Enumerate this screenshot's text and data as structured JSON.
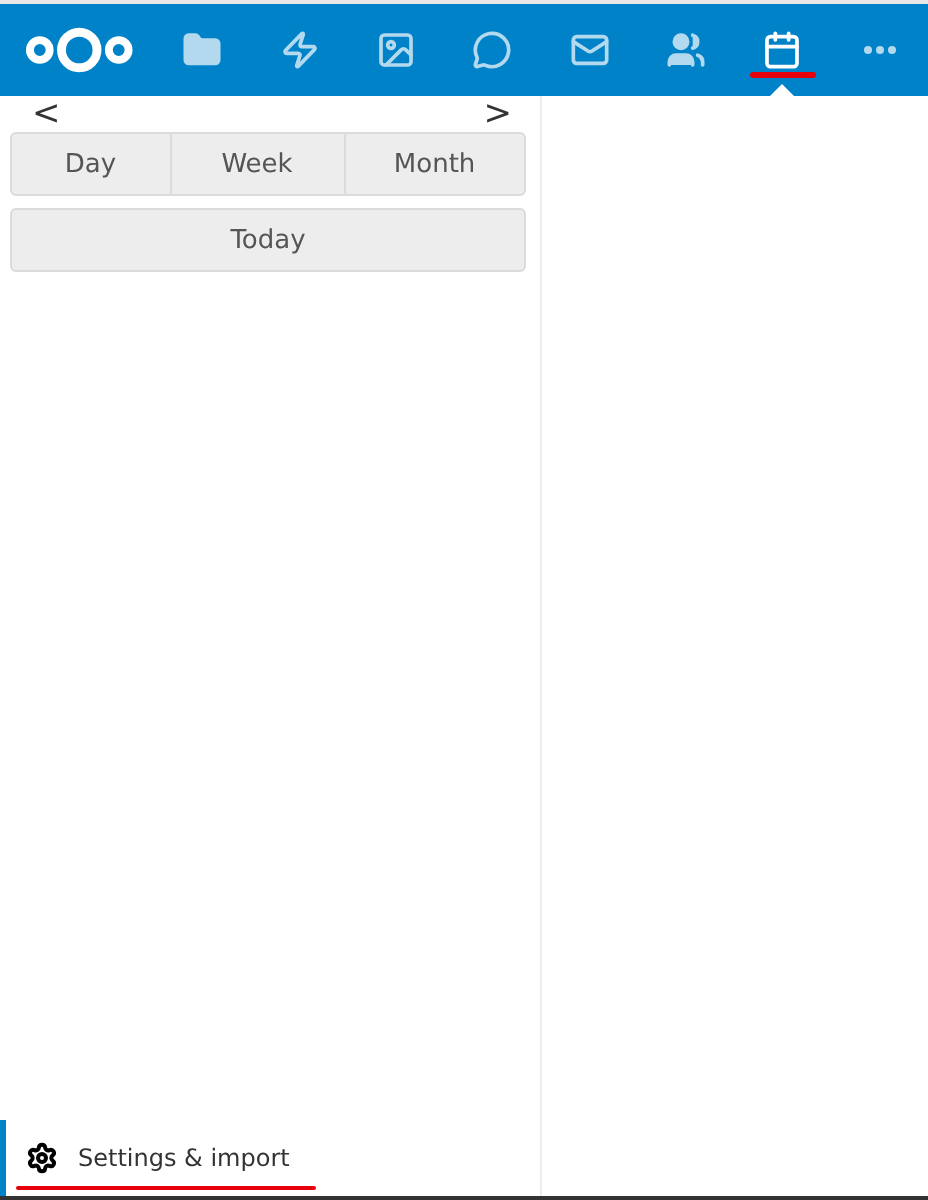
{
  "apps": [
    {
      "kind": "files",
      "selected": false
    },
    {
      "kind": "activity",
      "selected": false
    },
    {
      "kind": "photos",
      "selected": false
    },
    {
      "kind": "talk",
      "selected": false
    },
    {
      "kind": "mail",
      "selected": false
    },
    {
      "kind": "contacts",
      "selected": false
    },
    {
      "kind": "calendar",
      "selected": true
    },
    {
      "kind": "more",
      "selected": false
    }
  ],
  "navigation": {
    "previous": "<",
    "next": ">"
  },
  "views": [
    {
      "label": "Day"
    },
    {
      "label": "Week"
    },
    {
      "label": "Month"
    }
  ],
  "today_button": "Today",
  "settings": {
    "label": "Settings & import",
    "selected": true
  }
}
